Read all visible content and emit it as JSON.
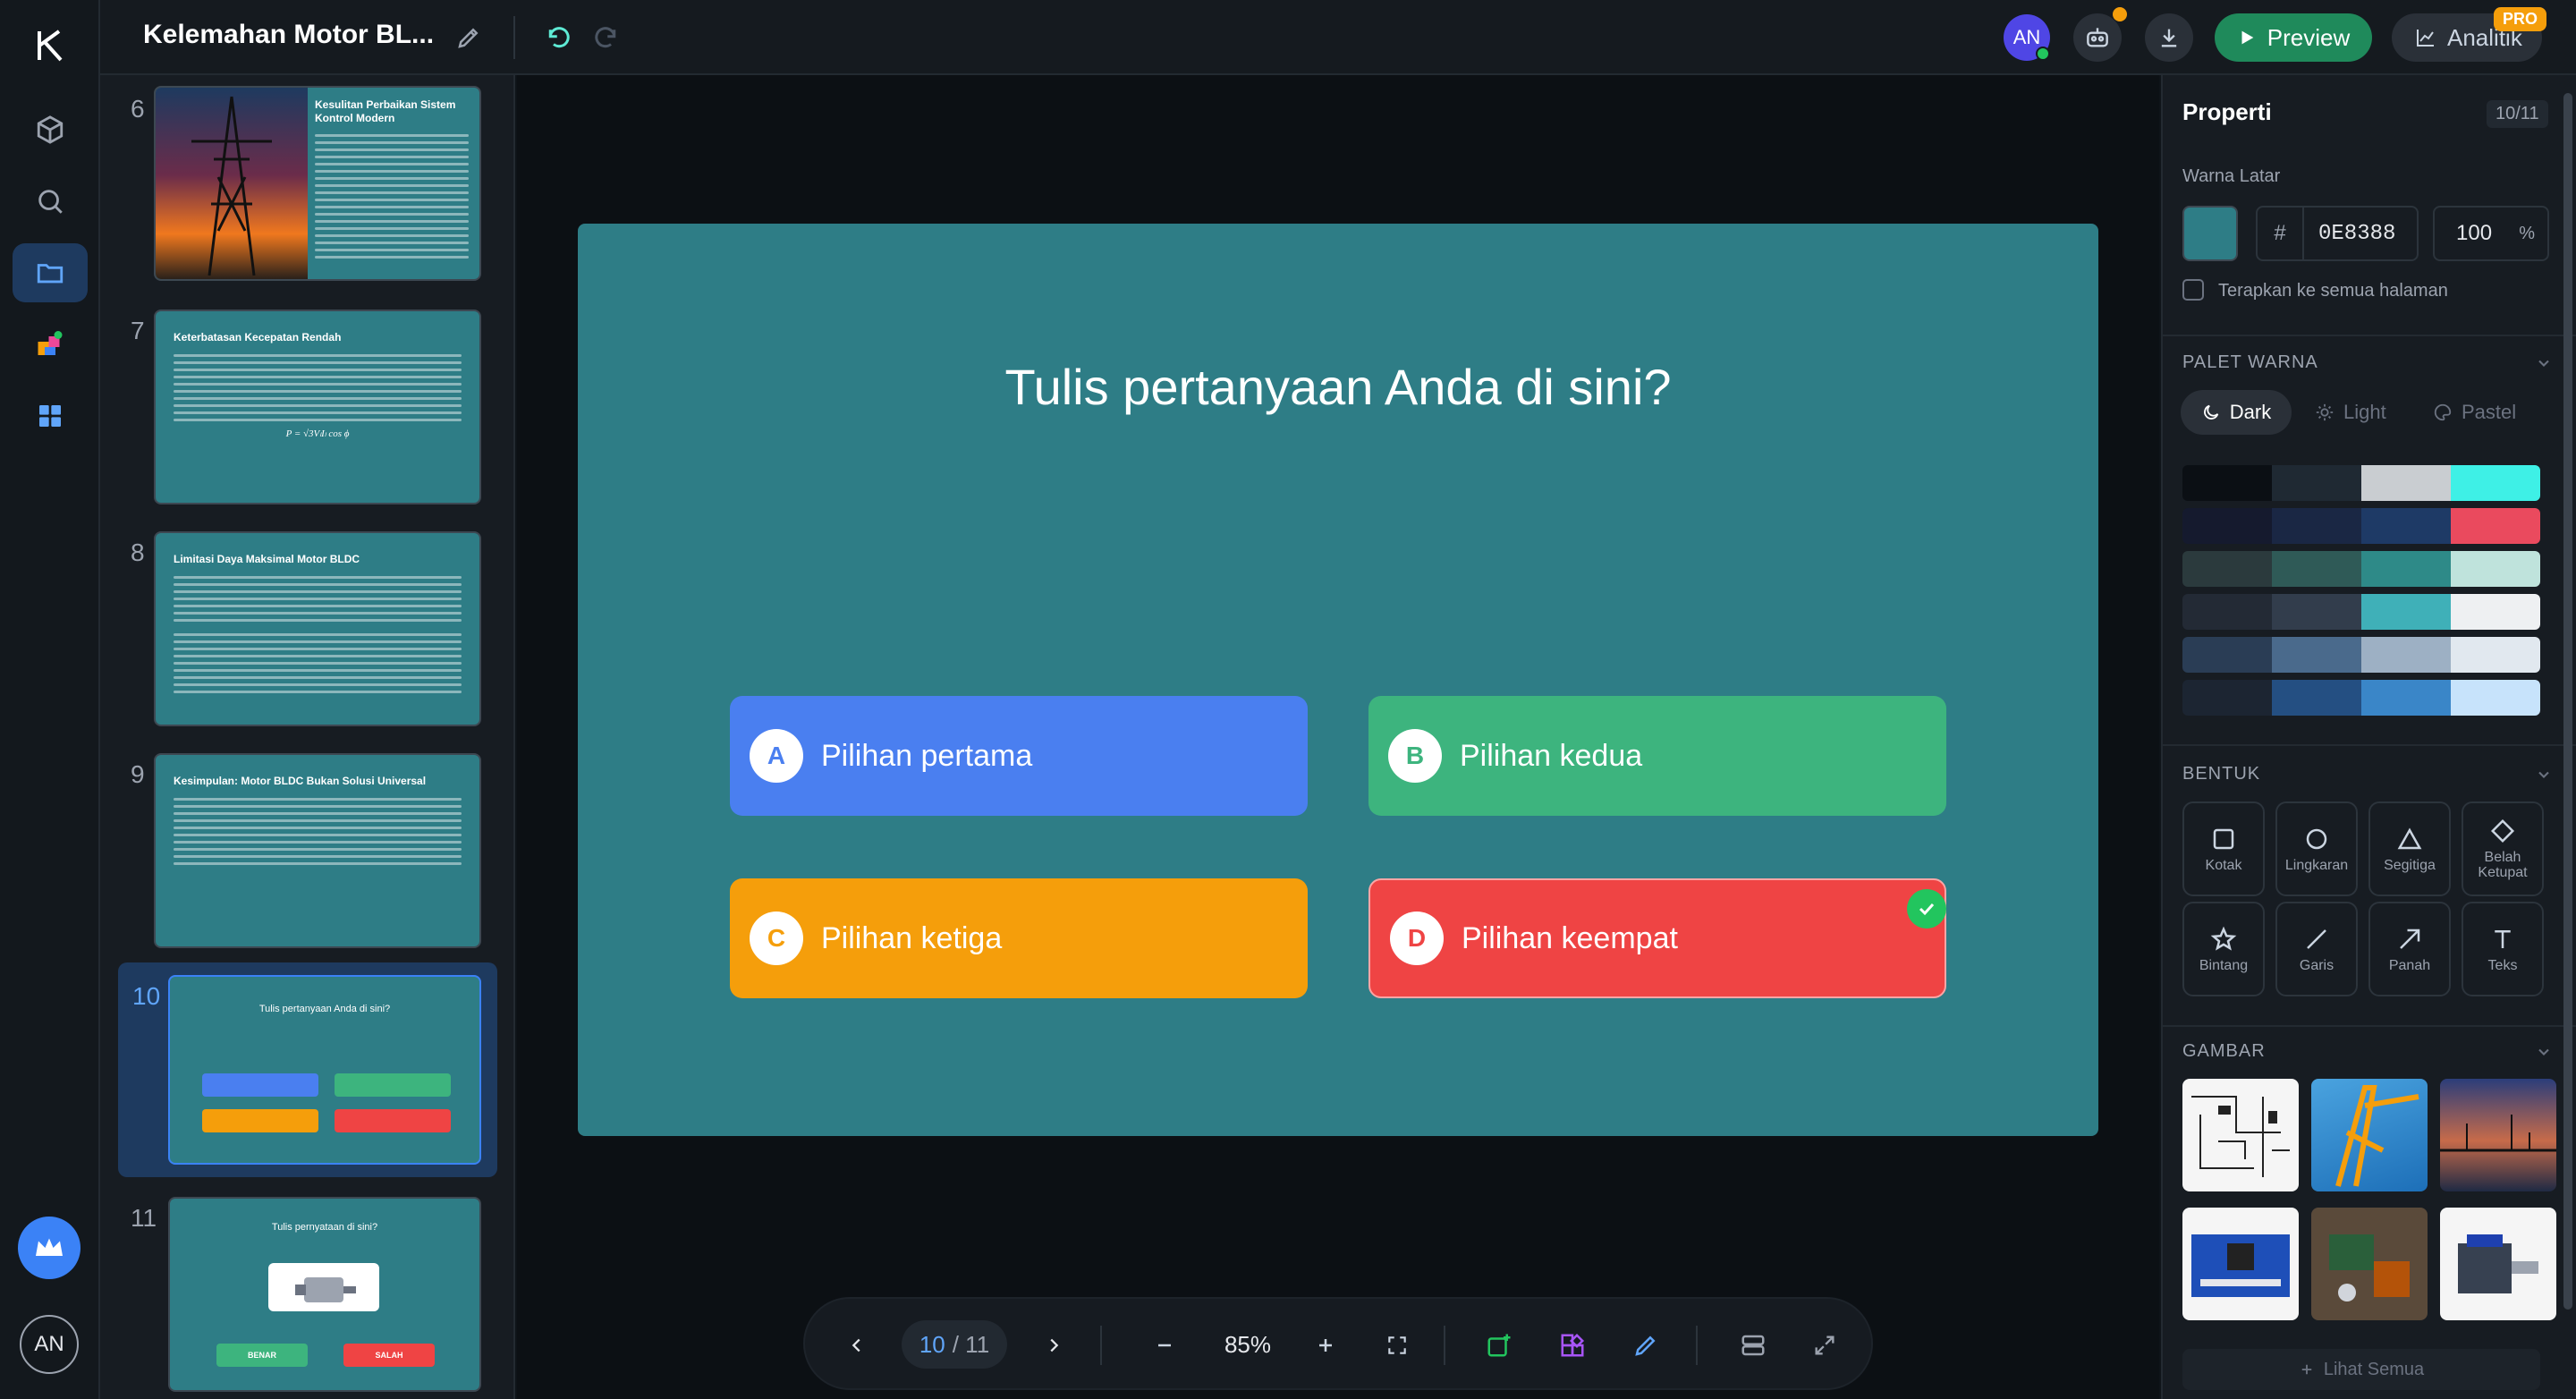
{
  "app": {
    "title": "Kelemahan Motor BL...",
    "avatar_initials": "AN"
  },
  "topbar": {
    "preview_label": "Preview",
    "analitik_label": "Analitik",
    "pro_badge": "PRO"
  },
  "thumbnails": [
    {
      "num": "6",
      "title": "Kesulitan Perbaikan Sistem Kontrol Modern"
    },
    {
      "num": "7",
      "title": "Keterbatasan Kecepatan Rendah",
      "formula": "P = √3VₗIₗ cos ϕ"
    },
    {
      "num": "8",
      "title": "Limitasi Daya Maksimal Motor BLDC"
    },
    {
      "num": "9",
      "title": "Kesimpulan: Motor BLDC Bukan Solusi Universal"
    },
    {
      "num": "10",
      "title": "Tulis pertanyaan Anda di sini?"
    },
    {
      "num": "11",
      "title": "Tulis pernyataan di sini?",
      "btn_true": "BENAR",
      "btn_false": "SALAH"
    }
  ],
  "slide": {
    "question": "Tulis pertanyaan Anda di sini?",
    "options": [
      {
        "letter": "A",
        "label": "Pilihan pertama",
        "color": "#4a7ff0"
      },
      {
        "letter": "B",
        "label": "Pilihan kedua",
        "color": "#3db47e"
      },
      {
        "letter": "C",
        "label": "Pilihan ketiga",
        "color": "#f59e0b"
      },
      {
        "letter": "D",
        "label": "Pilihan keempat",
        "color": "#ef4444",
        "correct": true
      }
    ],
    "background": "#2e7d86"
  },
  "bottombar": {
    "page_current": "10",
    "page_total": "/ 11",
    "zoom": "85%"
  },
  "properties": {
    "title": "Properti",
    "page_indicator": "10/11",
    "bg_label": "Warna Latar",
    "hash": "#",
    "hex_value": "0E8388",
    "opacity": "100",
    "opacity_unit": "%",
    "apply_all": "Terapkan ke semua halaman",
    "palette_title": "PALET WARNA",
    "palette_tabs": [
      "Dark",
      "Light",
      "Pastel"
    ],
    "palettes": [
      [
        "#0b0f14",
        "#1f2933",
        "#c9cdd1",
        "#3ef0e6"
      ],
      [
        "#151a2e",
        "#1a2744",
        "#1e3a66",
        "#ea4a5e"
      ],
      [
        "#2b3a3d",
        "#2f5a57",
        "#2e8a88",
        "#bfe3dc"
      ],
      [
        "#232a35",
        "#323d4c",
        "#3fb0b8",
        "#eef0f2"
      ],
      [
        "#2a3d55",
        "#4a6a8c",
        "#9db0c4",
        "#e1e8ef"
      ],
      [
        "#1c2532",
        "#244f82",
        "#3a86c8",
        "#c7e3fb"
      ]
    ],
    "shapes_title": "BENTUK",
    "shapes": [
      "Kotak",
      "Lingkaran",
      "Segitiga",
      "Belah Ketupat",
      "Bintang",
      "Garis",
      "Panah",
      "Teks"
    ],
    "images_title": "GAMBAR",
    "see_all": "Lihat Semua"
  }
}
